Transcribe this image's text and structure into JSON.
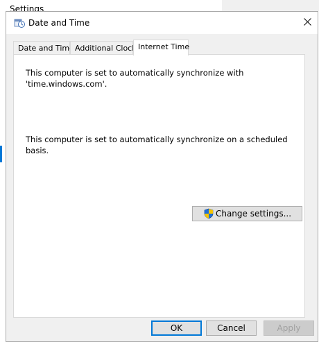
{
  "background": {
    "settings_title": "Settings"
  },
  "dialog": {
    "title": "Date and Time",
    "tabs": [
      {
        "label": "Date and Time",
        "active": false
      },
      {
        "label": "Additional Clocks",
        "active": false
      },
      {
        "label": "Internet Time",
        "active": true
      }
    ],
    "panel": {
      "message1": "This computer is set to automatically synchronize with 'time.windows.com'.",
      "message2": "This computer is set to automatically synchronize on a scheduled basis.",
      "change_settings_label": "Change settings..."
    },
    "buttons": {
      "ok": "OK",
      "cancel": "Cancel",
      "apply": "Apply"
    }
  },
  "colors": {
    "accent": "#0078d7",
    "shield_blue": "#1e6fd9",
    "shield_yellow": "#f5c400"
  },
  "icons": {
    "title_icon": "date-time-icon",
    "close_icon": "close-icon",
    "shield_icon": "uac-shield-icon"
  }
}
